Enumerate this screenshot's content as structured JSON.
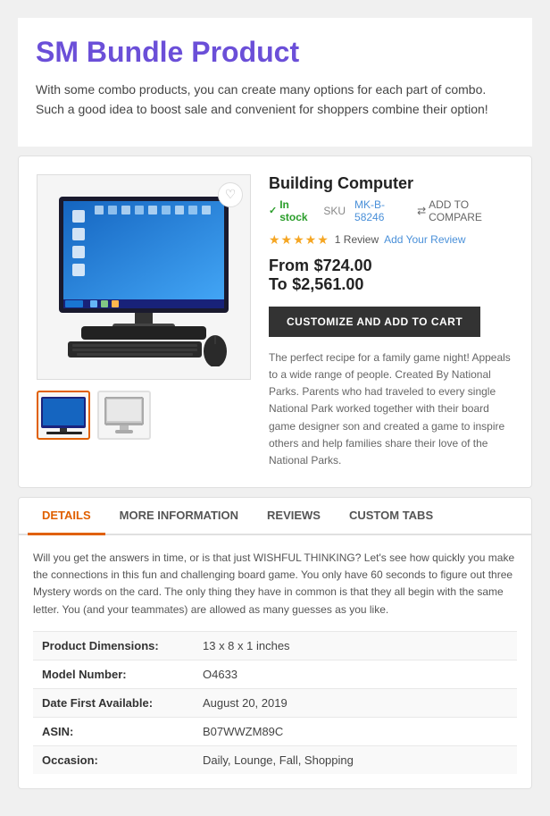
{
  "header": {
    "title": "SM Bundle Product",
    "description": "With some combo products, you can create many options for each part of combo. Such a good idea to boost sale and convenient for shoppers combine their option!"
  },
  "product": {
    "title": "Building Computer",
    "in_stock": "In stock",
    "sku_label": "SKU",
    "sku_value": "MK-B-58246",
    "compare_label": "ADD TO COMPARE",
    "stars": "★★★★★",
    "review_count": "1 Review",
    "add_review": "Add Your Review",
    "price_from_label": "From",
    "price_from": "$724.00",
    "price_to_label": "To",
    "price_to": "$2,561.00",
    "customize_btn": "CUSTOMIZE AND ADD TO CART",
    "description": "The perfect recipe for a family game night! Appeals to a wide range of people. Created By National Parks. Parents who had traveled to every single National Park worked together with their board game designer son and created a game to inspire others and help families share their love of the National Parks."
  },
  "tabs": {
    "items": [
      {
        "label": "DETAILS",
        "active": true
      },
      {
        "label": "MORE INFORMATION",
        "active": false
      },
      {
        "label": "REVIEWS",
        "active": false
      },
      {
        "label": "CUSTOM TABS",
        "active": false
      }
    ],
    "details_text": "Will you get the answers in time, or is that just WISHFUL THINKING? Let's see how quickly you make the connections in this fun and challenging board game. You only have 60 seconds to figure out three Mystery words on the card. The only thing they have in common is that they all begin with the same letter. You (and your teammates) are allowed as many guesses as you like.",
    "specs": [
      {
        "label": "Product Dimensions:",
        "value": "13 x 8 x 1 inches"
      },
      {
        "label": "Model Number:",
        "value": "O4633"
      },
      {
        "label": "Date First Available:",
        "value": "August 20, 2019"
      },
      {
        "label": "ASIN:",
        "value": "B07WWZM89C"
      },
      {
        "label": "Occasion:",
        "value": "Daily, Lounge, Fall, Shopping"
      }
    ]
  },
  "icons": {
    "heart": "♡",
    "compare": "⇄",
    "checkmark": "✓"
  }
}
